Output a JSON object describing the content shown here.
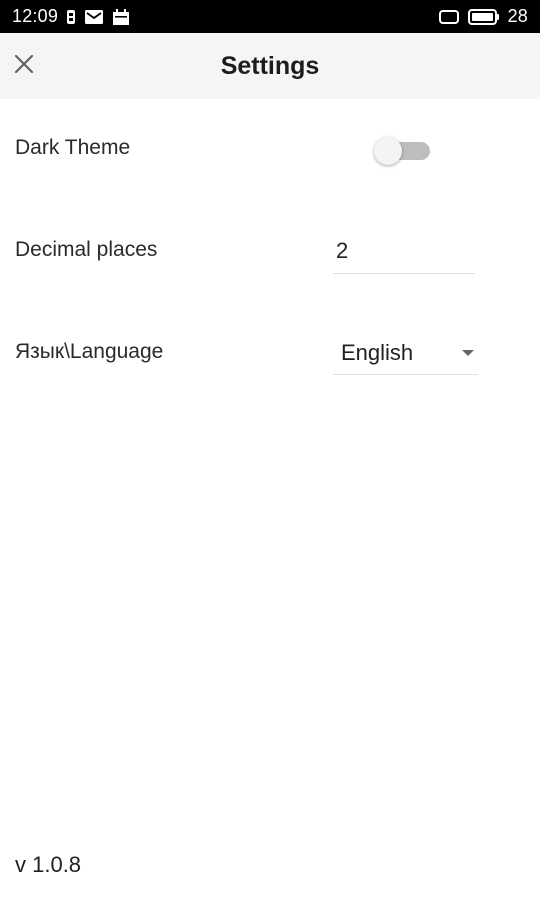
{
  "status_bar": {
    "time": "12:09",
    "battery_level": "28",
    "left_icons": [
      "sim-card-icon",
      "mail-icon",
      "calendar-icon"
    ],
    "right_icons": [
      "screen-rotate-icon",
      "battery-icon"
    ]
  },
  "app_bar": {
    "title": "Settings",
    "close_icon": "close-icon",
    "background": "#f5f5f5"
  },
  "settings": {
    "dark_theme": {
      "label": "Dark Theme",
      "enabled": false
    },
    "decimal_places": {
      "label": "Decimal places",
      "value": "2"
    },
    "language": {
      "label": "Язык\\Language",
      "selected": "English"
    }
  },
  "footer": {
    "version": "v 1.0.8"
  }
}
